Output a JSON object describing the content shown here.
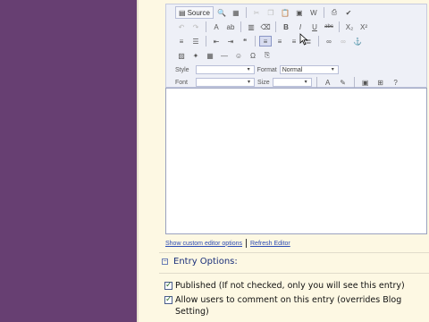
{
  "toolbar": {
    "source_label": "Source",
    "style_label": "Style",
    "style_value": "",
    "format_label": "Format",
    "format_value": "Normal",
    "font_label": "Font",
    "font_value": "",
    "size_label": "Size",
    "size_value": "",
    "bold": "B",
    "italic": "I",
    "underline": "U",
    "strike": "abc",
    "subscript": "X₂",
    "superscript": "X²"
  },
  "editor": {
    "content": ""
  },
  "links": {
    "custom": "Show custom editor options",
    "refresh": "Refresh Editor"
  },
  "entry_options": {
    "toggle": "−",
    "title": "Entry Options:",
    "published": "Published (If not checked, only you will see this entry)",
    "comments": "Allow users to comment on this entry (overrides Blog Setting)"
  },
  "colors": {
    "sidebar": "#673f72",
    "background": "#fdf8e3",
    "link": "#2b4bb3"
  }
}
